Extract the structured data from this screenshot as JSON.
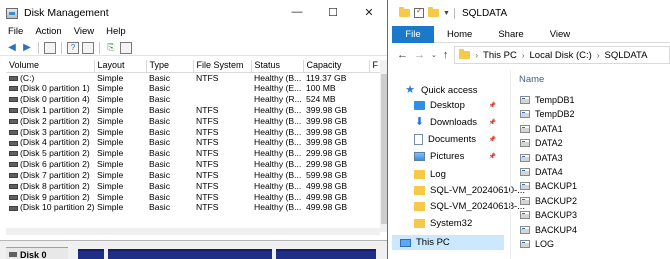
{
  "disk_management": {
    "title": "Disk Management",
    "window_buttons": {
      "minimize": "—",
      "maximize": "☐",
      "close": "✕"
    },
    "menu": [
      "File",
      "Action",
      "View",
      "Help"
    ],
    "columns": [
      "Volume",
      "Layout",
      "Type",
      "File System",
      "Status",
      "Capacity",
      "F"
    ],
    "rows": [
      {
        "volume": "(C:)",
        "layout": "Simple",
        "type": "Basic",
        "fs": "NTFS",
        "status": "Healthy (B...",
        "capacity": "119.37 GB"
      },
      {
        "volume": "(Disk 0 partition 1)",
        "layout": "Simple",
        "type": "Basic",
        "fs": "",
        "status": "Healthy (E...",
        "capacity": "100 MB"
      },
      {
        "volume": "(Disk 0 partition 4)",
        "layout": "Simple",
        "type": "Basic",
        "fs": "",
        "status": "Healthy (R...",
        "capacity": "524 MB"
      },
      {
        "volume": "(Disk 1 partition 2)",
        "layout": "Simple",
        "type": "Basic",
        "fs": "NTFS",
        "status": "Healthy (B...",
        "capacity": "399.98 GB"
      },
      {
        "volume": "(Disk 2 partition 2)",
        "layout": "Simple",
        "type": "Basic",
        "fs": "NTFS",
        "status": "Healthy (B...",
        "capacity": "399.98 GB"
      },
      {
        "volume": "(Disk 3 partition 2)",
        "layout": "Simple",
        "type": "Basic",
        "fs": "NTFS",
        "status": "Healthy (B...",
        "capacity": "399.98 GB"
      },
      {
        "volume": "(Disk 4 partition 2)",
        "layout": "Simple",
        "type": "Basic",
        "fs": "NTFS",
        "status": "Healthy (B...",
        "capacity": "399.98 GB"
      },
      {
        "volume": "(Disk 5 partition 2)",
        "layout": "Simple",
        "type": "Basic",
        "fs": "NTFS",
        "status": "Healthy (B...",
        "capacity": "299.98 GB"
      },
      {
        "volume": "(Disk 6 partition 2)",
        "layout": "Simple",
        "type": "Basic",
        "fs": "NTFS",
        "status": "Healthy (B...",
        "capacity": "299.98 GB"
      },
      {
        "volume": "(Disk 7 partition 2)",
        "layout": "Simple",
        "type": "Basic",
        "fs": "NTFS",
        "status": "Healthy (B...",
        "capacity": "599.98 GB"
      },
      {
        "volume": "(Disk 8 partition 2)",
        "layout": "Simple",
        "type": "Basic",
        "fs": "NTFS",
        "status": "Healthy (B...",
        "capacity": "499.98 GB"
      },
      {
        "volume": "(Disk 9 partition 2)",
        "layout": "Simple",
        "type": "Basic",
        "fs": "NTFS",
        "status": "Healthy (B...",
        "capacity": "499.98 GB"
      },
      {
        "volume": "(Disk 10 partition 2)",
        "layout": "Simple",
        "type": "Basic",
        "fs": "NTFS",
        "status": "Healthy (B...",
        "capacity": "499.98 GB"
      }
    ],
    "disk_label": "Disk 0",
    "partition_color": "#1f2f88"
  },
  "explorer": {
    "title": "SQLDATA",
    "tabs": {
      "file": "File",
      "home": "Home",
      "share": "Share",
      "view": "View"
    },
    "file_tab_color": "#1979ca",
    "address": [
      "This PC",
      "Local Disk (C:)",
      "SQLDATA"
    ],
    "nav": [
      {
        "label": "Quick access",
        "icon": "star-icon",
        "pinned": false
      },
      {
        "label": "Desktop",
        "icon": "desktop-icon",
        "pinned": true
      },
      {
        "label": "Downloads",
        "icon": "download-icon",
        "pinned": true
      },
      {
        "label": "Documents",
        "icon": "document-icon",
        "pinned": true
      },
      {
        "label": "Pictures",
        "icon": "pictures-icon",
        "pinned": true
      },
      {
        "label": "Log",
        "icon": "folder-icon",
        "pinned": false
      },
      {
        "label": "SQL-VM_20240610-...",
        "icon": "folder-icon",
        "pinned": false
      },
      {
        "label": "SQL-VM_20240618-...",
        "icon": "folder-icon",
        "pinned": false
      },
      {
        "label": "System32",
        "icon": "folder-icon",
        "pinned": false
      },
      {
        "label": "This PC",
        "icon": "computer-icon",
        "pinned": false,
        "selected": true
      }
    ],
    "column_header": "Name",
    "files": [
      "TempDB1",
      "TempDB2",
      "DATA1",
      "DATA2",
      "DATA3",
      "DATA4",
      "BACKUP1",
      "BACKUP2",
      "BACKUP3",
      "BACKUP4",
      "LOG"
    ]
  }
}
